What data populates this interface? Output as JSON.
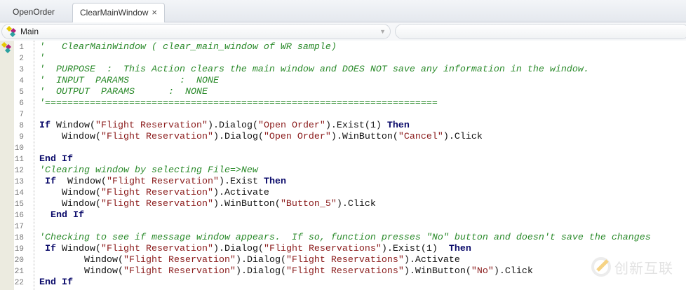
{
  "tabs": [
    {
      "label": "OpenOrder",
      "active": false
    },
    {
      "label": "ClearMainWindow",
      "active": true,
      "close": "×"
    }
  ],
  "action_selector": {
    "value": "Main",
    "arrow": "▼"
  },
  "watermark": {
    "text": "创新互联"
  },
  "colors": {
    "comment": "#2a8a2a",
    "keyword": "#0a0a6a",
    "string": "#8a1a1a"
  },
  "lines": [
    {
      "n": "1",
      "tokens": [
        {
          "k": "c",
          "t": "'   ClearMainWindow ( clear_main_window of WR sample)"
        }
      ]
    },
    {
      "n": "2",
      "tokens": [
        {
          "k": "c",
          "t": "'"
        }
      ]
    },
    {
      "n": "3",
      "tokens": [
        {
          "k": "c",
          "t": "'  PURPOSE  :  This Action clears the main window and DOES NOT save any information in the window."
        }
      ]
    },
    {
      "n": "4",
      "tokens": [
        {
          "k": "c",
          "t": "'  INPUT  PARAMS         :  NONE"
        }
      ]
    },
    {
      "n": "5",
      "tokens": [
        {
          "k": "c",
          "t": "'  OUTPUT  PARAMS      :  NONE"
        }
      ]
    },
    {
      "n": "6",
      "tokens": [
        {
          "k": "c",
          "t": "'======================================================================"
        }
      ]
    },
    {
      "n": "7",
      "tokens": []
    },
    {
      "n": "8",
      "tokens": [
        {
          "k": "k",
          "t": "If"
        },
        {
          "k": "p",
          "t": " Window("
        },
        {
          "k": "s",
          "t": "\"Flight Reservation\""
        },
        {
          "k": "p",
          "t": ").Dialog("
        },
        {
          "k": "s",
          "t": "\"Open Order\""
        },
        {
          "k": "p",
          "t": ").Exist(1) "
        },
        {
          "k": "k",
          "t": "Then"
        }
      ]
    },
    {
      "n": "9",
      "tokens": [
        {
          "k": "p",
          "t": "    Window("
        },
        {
          "k": "s",
          "t": "\"Flight Reservation\""
        },
        {
          "k": "p",
          "t": ").Dialog("
        },
        {
          "k": "s",
          "t": "\"Open Order\""
        },
        {
          "k": "p",
          "t": ").WinButton("
        },
        {
          "k": "s",
          "t": "\"Cancel\""
        },
        {
          "k": "p",
          "t": ").Click"
        }
      ]
    },
    {
      "n": "10",
      "tokens": []
    },
    {
      "n": "11",
      "tokens": [
        {
          "k": "k",
          "t": "End If"
        }
      ]
    },
    {
      "n": "12",
      "tokens": [
        {
          "k": "c",
          "t": "'Clearing window by selecting File=>New"
        }
      ]
    },
    {
      "n": "13",
      "tokens": [
        {
          "k": "k",
          "t": " If"
        },
        {
          "k": "p",
          "t": "  Window("
        },
        {
          "k": "s",
          "t": "\"Flight Reservation\""
        },
        {
          "k": "p",
          "t": ").Exist "
        },
        {
          "k": "k",
          "t": "Then"
        }
      ]
    },
    {
      "n": "14",
      "tokens": [
        {
          "k": "p",
          "t": "    Window("
        },
        {
          "k": "s",
          "t": "\"Flight Reservation\""
        },
        {
          "k": "p",
          "t": ").Activate"
        }
      ]
    },
    {
      "n": "15",
      "tokens": [
        {
          "k": "p",
          "t": "    Window("
        },
        {
          "k": "s",
          "t": "\"Flight Reservation\""
        },
        {
          "k": "p",
          "t": ").WinButton("
        },
        {
          "k": "s",
          "t": "\"Button_5\""
        },
        {
          "k": "p",
          "t": ").Click"
        }
      ]
    },
    {
      "n": "16",
      "tokens": [
        {
          "k": "k",
          "t": "  End If"
        }
      ]
    },
    {
      "n": "17",
      "tokens": []
    },
    {
      "n": "18",
      "tokens": [
        {
          "k": "c",
          "t": "'Checking to see if message window appears.  If so, function presses \"No\" button and doesn't save the changes"
        }
      ]
    },
    {
      "n": "19",
      "tokens": [
        {
          "k": "k",
          "t": " If"
        },
        {
          "k": "p",
          "t": " Window("
        },
        {
          "k": "s",
          "t": "\"Flight Reservation\""
        },
        {
          "k": "p",
          "t": ").Dialog("
        },
        {
          "k": "s",
          "t": "\"Flight Reservations\""
        },
        {
          "k": "p",
          "t": ").Exist(1)  "
        },
        {
          "k": "k",
          "t": "Then"
        }
      ]
    },
    {
      "n": "20",
      "tokens": [
        {
          "k": "p",
          "t": "        Window("
        },
        {
          "k": "s",
          "t": "\"Flight Reservation\""
        },
        {
          "k": "p",
          "t": ").Dialog("
        },
        {
          "k": "s",
          "t": "\"Flight Reservations\""
        },
        {
          "k": "p",
          "t": ").Activate"
        }
      ]
    },
    {
      "n": "21",
      "tokens": [
        {
          "k": "p",
          "t": "        Window("
        },
        {
          "k": "s",
          "t": "\"Flight Reservation\""
        },
        {
          "k": "p",
          "t": ").Dialog("
        },
        {
          "k": "s",
          "t": "\"Flight Reservations\""
        },
        {
          "k": "p",
          "t": ").WinButton("
        },
        {
          "k": "s",
          "t": "\"No\""
        },
        {
          "k": "p",
          "t": ").Click"
        }
      ]
    },
    {
      "n": "22",
      "tokens": [
        {
          "k": "k",
          "t": "End If"
        }
      ]
    }
  ]
}
